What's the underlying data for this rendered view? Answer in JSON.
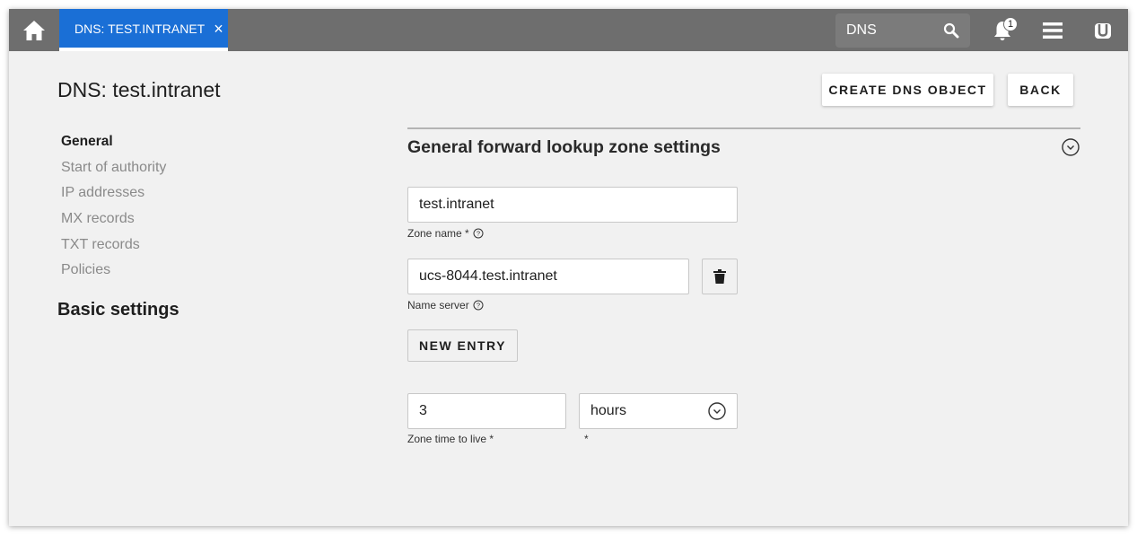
{
  "topbar": {
    "tab_label": "DNS: TEST.INTRANET",
    "tab_close": "×",
    "search_value": "DNS",
    "notification_count": "1",
    "accent_color": "#1a6fd6"
  },
  "header": {
    "title": "DNS: test.intranet",
    "create_button": "CREATE DNS OBJECT",
    "back_button": "BACK"
  },
  "sidebar": {
    "items": [
      {
        "label": "General",
        "active": true
      },
      {
        "label": "Start of authority"
      },
      {
        "label": "IP addresses"
      },
      {
        "label": "MX records"
      },
      {
        "label": "TXT records"
      },
      {
        "label": "Policies"
      }
    ],
    "section_heading": "Basic settings"
  },
  "form": {
    "section_title": "General forward lookup zone settings",
    "zone_name": {
      "value": "test.intranet",
      "label": "Zone name *"
    },
    "name_server": {
      "value": "ucs-8044.test.intranet",
      "label": "Name server"
    },
    "new_entry_button": "NEW ENTRY",
    "ttl": {
      "value": "3",
      "label": "Zone time to live *"
    },
    "ttl_unit": {
      "value": "hours",
      "label": "*"
    }
  }
}
